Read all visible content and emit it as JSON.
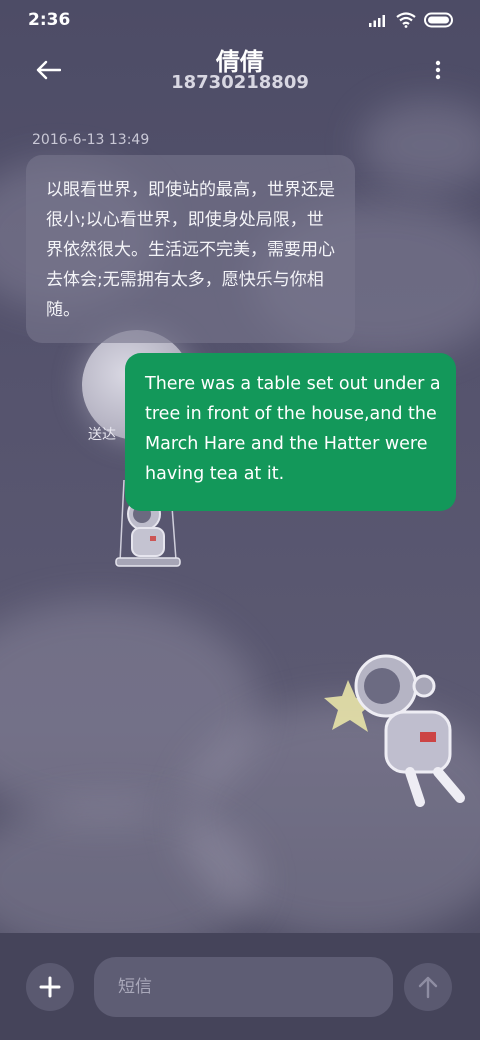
{
  "status_bar": {
    "time": "2:36",
    "icons": [
      "signal-icon",
      "wifi-icon",
      "battery-icon"
    ]
  },
  "header": {
    "contact_name": "倩倩",
    "contact_number": "18730218809",
    "back_icon": "back-arrow-icon",
    "more_icon": "more-vertical-icon"
  },
  "conversation": {
    "timestamp": "2016-6-13 13:49",
    "messages": [
      {
        "direction": "incoming",
        "text": "以眼看世界，即使站的最高，世界还是很小;以心看世界，即使身处局限，世界依然很大。生活远不完美，需要用心去体会;无需拥有太多，愿快乐与你相随。"
      },
      {
        "direction": "outgoing",
        "text": "There was a table set out under a tree in front of the house,and the March Hare and the Hatter were having tea at it.",
        "status": "送达"
      }
    ]
  },
  "composer": {
    "placeholder": "短信",
    "add_icon": "plus-icon",
    "send_icon": "send-arrow-icon"
  },
  "colors": {
    "background": "#4b4a62",
    "outgoing_bubble": "#13985a",
    "incoming_bubble": "#78768c",
    "bottom_bar": "#45445a"
  }
}
